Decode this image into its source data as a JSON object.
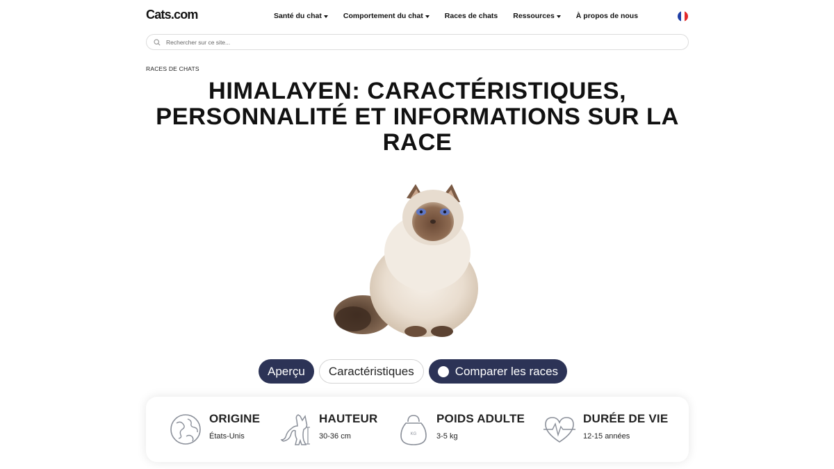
{
  "header": {
    "logo": "Cats.com",
    "nav": [
      {
        "label": "Santé du chat",
        "has_dropdown": true
      },
      {
        "label": "Comportement du chat",
        "has_dropdown": true
      },
      {
        "label": "Races de chats",
        "has_dropdown": false
      },
      {
        "label": "Ressources",
        "has_dropdown": true
      },
      {
        "label": "À propos de nous",
        "has_dropdown": false
      }
    ],
    "language_flag": "french-flag-icon",
    "flag_colors": [
      "#1f3fa6",
      "#ffffff",
      "#e32b2b"
    ]
  },
  "search": {
    "placeholder": "Rechercher sur ce site..."
  },
  "breadcrumb": "RACES DE CHATS",
  "title": "HIMALAYEN: CARACTÉRISTIQUES, PERSONNALITÉ ET INFORMATIONS SUR LA RACE",
  "hero": {
    "icon": "himalayan-cat-photo"
  },
  "tabs": [
    {
      "label": "Aperçu",
      "active": true
    },
    {
      "label": "Caractéristiques",
      "active": false
    },
    {
      "label": "Comparer les races",
      "active": true
    }
  ],
  "facts": [
    {
      "icon": "globe-icon",
      "label": "ORIGINE",
      "value": "États-Unis"
    },
    {
      "icon": "cat-silhouette-icon",
      "label": "HAUTEUR",
      "value": "30-36 cm"
    },
    {
      "icon": "kettlebell-weight-icon",
      "label": "POIDS ADULTE",
      "value": "3-5 kg"
    },
    {
      "icon": "heartbeat-icon",
      "label": "DURÉE DE VIE",
      "value": "12-15 années"
    }
  ],
  "colors": {
    "accent_dark": "#2c3356",
    "icon_gray": "#8a8f99"
  }
}
